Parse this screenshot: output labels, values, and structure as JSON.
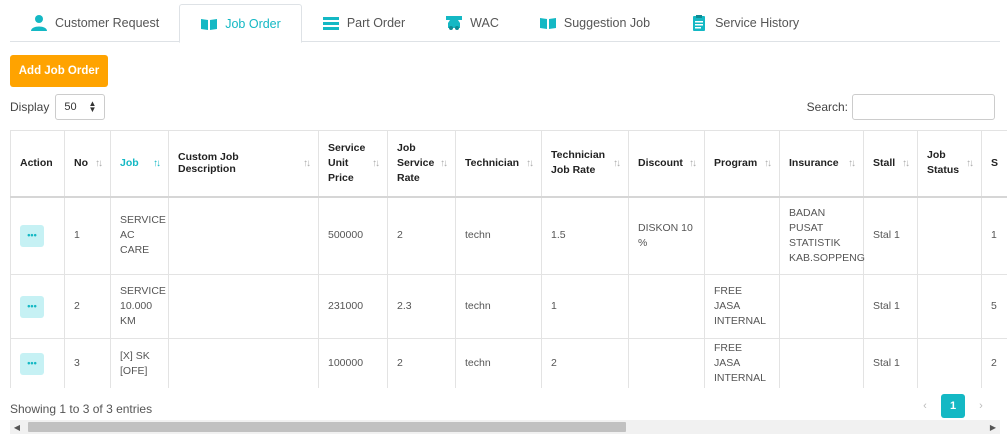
{
  "tabs": [
    {
      "label": "Customer Request",
      "icon": "user-icon"
    },
    {
      "label": "Job Order",
      "icon": "book-icon"
    },
    {
      "label": "Part Order",
      "icon": "list-icon"
    },
    {
      "label": "WAC",
      "icon": "car-wash-icon"
    },
    {
      "label": "Suggestion Job",
      "icon": "book-icon"
    },
    {
      "label": "Service History",
      "icon": "clipboard-icon"
    }
  ],
  "active_tab": "Job Order",
  "accent_color": "#14b8c4",
  "add_button_color": "#ffa300",
  "toolbar": {
    "add_label": "Add Job Order"
  },
  "display": {
    "label": "Display",
    "value": "50"
  },
  "search": {
    "label": "Search:",
    "value": ""
  },
  "table": {
    "headers": [
      "Action",
      "No",
      "Job",
      "Custom Job Description",
      "Service Unit Price",
      "Job Service Rate",
      "Technician",
      "Technician Job Rate",
      "Discount",
      "Program",
      "Insurance",
      "Stall",
      "Job Status",
      "S"
    ],
    "rows": [
      {
        "no": "1",
        "job": "SERVICE AC CARE",
        "custom": "",
        "price": "500000",
        "rate": "2",
        "tech": "techn",
        "tech_rate": "1.5",
        "discount": "DISKON 10 %",
        "program": "",
        "insurance": "BADAN PUSAT STATISTIK KAB.SOPPENG",
        "stall": "Stal 1",
        "status": "",
        "s": "1"
      },
      {
        "no": "2",
        "job": "SERVICE 10.000 KM",
        "custom": "",
        "price": "231000",
        "rate": "2.3",
        "tech": "techn",
        "tech_rate": "1",
        "discount": "",
        "program": "FREE JASA INTERNAL",
        "insurance": "",
        "stall": "Stal 1",
        "status": "",
        "s": "5"
      },
      {
        "no": "3",
        "job": "[X] SK [OFE]",
        "custom": "",
        "price": "100000",
        "rate": "2",
        "tech": "techn",
        "tech_rate": "2",
        "discount": "",
        "program": "FREE JASA INTERNAL",
        "insurance": "",
        "stall": "Stal 1",
        "status": "",
        "s": "2"
      }
    ]
  },
  "footer": {
    "showing": "Showing 1 to 3 of 3 entries"
  },
  "pager": {
    "prev": "‹",
    "current": "1",
    "next": "›"
  },
  "scrollbar": {
    "left": "◀",
    "right": "▶"
  }
}
